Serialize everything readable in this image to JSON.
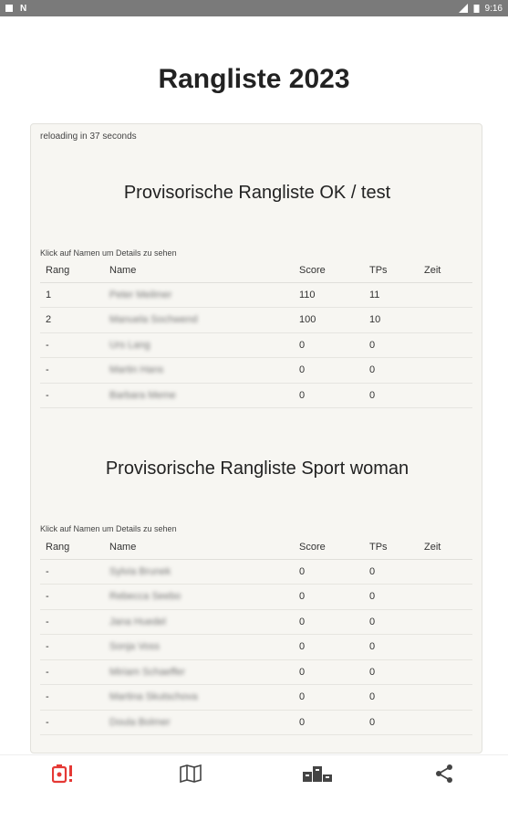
{
  "status": {
    "time": "9:16"
  },
  "title": "Rangliste 2023",
  "reload_text": "reloading in 37 seconds",
  "columns": {
    "rang": "Rang",
    "name": "Name",
    "score": "Score",
    "tps": "TPs",
    "zeit": "Zeit"
  },
  "sections": [
    {
      "title": "Provisorische Rangliste OK / test",
      "hint": "Klick auf Namen um Details zu sehen",
      "rows": [
        {
          "rang": "1",
          "name": "Peter Meilmer",
          "score": "110",
          "tps": "11",
          "zeit": ""
        },
        {
          "rang": "2",
          "name": "Manuela Sochwend",
          "score": "100",
          "tps": "10",
          "zeit": ""
        },
        {
          "rang": "-",
          "name": "Urs Lang",
          "score": "0",
          "tps": "0",
          "zeit": ""
        },
        {
          "rang": "-",
          "name": "Martin Hans",
          "score": "0",
          "tps": "0",
          "zeit": ""
        },
        {
          "rang": "-",
          "name": "Barbara Meme",
          "score": "0",
          "tps": "0",
          "zeit": ""
        }
      ]
    },
    {
      "title": "Provisorische Rangliste Sport woman",
      "hint": "Klick auf Namen um Details zu sehen",
      "rows": [
        {
          "rang": "-",
          "name": "Sylvia Brunek",
          "score": "0",
          "tps": "0",
          "zeit": ""
        },
        {
          "rang": "-",
          "name": "Rebecca Seebo",
          "score": "0",
          "tps": "0",
          "zeit": ""
        },
        {
          "rang": "-",
          "name": "Jana Huedel",
          "score": "0",
          "tps": "0",
          "zeit": ""
        },
        {
          "rang": "-",
          "name": "Sonja Voss",
          "score": "0",
          "tps": "0",
          "zeit": ""
        },
        {
          "rang": "-",
          "name": "Miriam Schaeffer",
          "score": "0",
          "tps": "0",
          "zeit": ""
        },
        {
          "rang": "-",
          "name": "Martina Skutschova",
          "score": "0",
          "tps": "0",
          "zeit": ""
        },
        {
          "rang": "-",
          "name": "Doula Bolmer",
          "score": "0",
          "tps": "0",
          "zeit": ""
        }
      ]
    }
  ],
  "bottom_nav": [
    {
      "icon": "alert-icon",
      "active": true
    },
    {
      "icon": "map-icon",
      "active": false
    },
    {
      "icon": "podium-icon",
      "active": false
    },
    {
      "icon": "share-icon",
      "active": false
    }
  ],
  "colors": {
    "accent": "#e53935",
    "icon": "#444444",
    "card_bg": "#f7f6f2"
  }
}
